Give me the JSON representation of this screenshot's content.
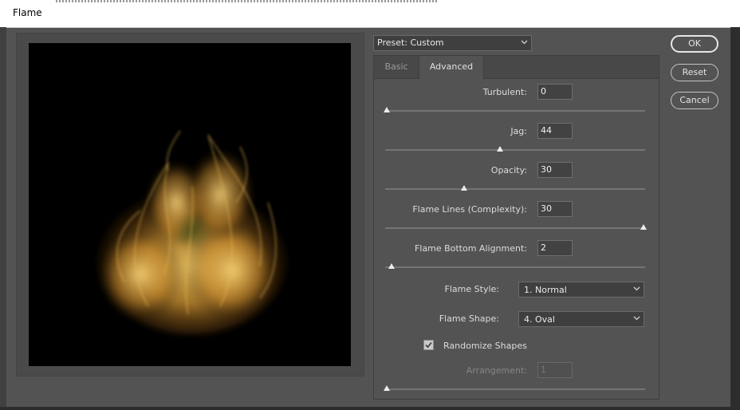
{
  "window": {
    "title": "Flame"
  },
  "preset": {
    "label": "Preset: Custom"
  },
  "tabs": [
    {
      "label": "Basic",
      "active": false
    },
    {
      "label": "Advanced",
      "active": true
    }
  ],
  "advanced": {
    "turbulent": {
      "label": "Turbulent:",
      "value": "0",
      "level": 0.0
    },
    "jag": {
      "label": "Jag:",
      "value": "44",
      "level": 0.44
    },
    "opacity": {
      "label": "Opacity:",
      "value": "30",
      "level": 0.3
    },
    "flame_lines": {
      "label": "Flame Lines (Complexity):",
      "value": "30",
      "level": 1.0
    },
    "bottom_alignment": {
      "label": "Flame Bottom Alignment:",
      "value": "2",
      "level": 0.02
    },
    "flame_style": {
      "label": "Flame Style:",
      "value": "1. Normal"
    },
    "flame_shape": {
      "label": "Flame Shape:",
      "value": "4. Oval"
    },
    "randomize": {
      "label": "Randomize Shapes",
      "checked": true
    },
    "arrangement": {
      "label": "Arrangement:",
      "value": "1",
      "level": 0.0,
      "disabled": true
    }
  },
  "buttons": {
    "ok": "OK",
    "reset": "Reset",
    "cancel": "Cancel"
  },
  "colors": {
    "flame_core": "#e7b64a",
    "flame_edge": "#7a4a12",
    "background": "#535353"
  }
}
